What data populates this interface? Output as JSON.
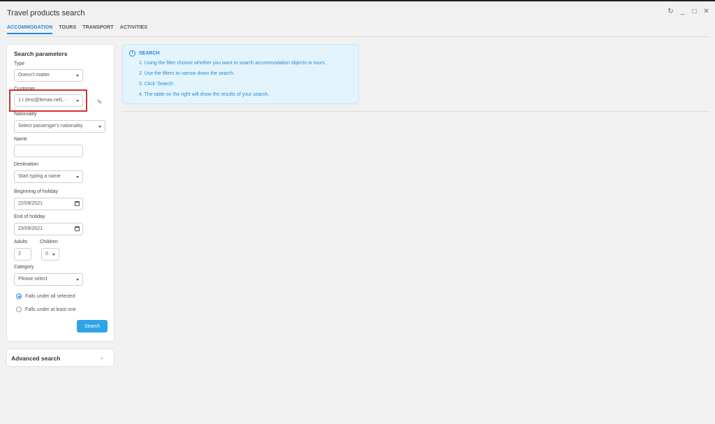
{
  "window": {
    "title": "Travel products search",
    "controls": [
      "refresh-icon",
      "minimize-icon",
      "maximize-icon",
      "close-icon"
    ]
  },
  "tabs": [
    {
      "label": "ACCOMMODATION",
      "active": true
    },
    {
      "label": "TOURS",
      "active": false
    },
    {
      "label": "TRANSPORT",
      "active": false
    },
    {
      "label": "ACTIVITIES",
      "active": false
    }
  ],
  "search_panel": {
    "title": "Search parameters",
    "type": {
      "label": "Type",
      "value": "Doesn't matter"
    },
    "customer": {
      "label": "Customer",
      "value": "1 t (test@lemax.net), -"
    },
    "nationality": {
      "label": "Nationality",
      "value": "Select passenger's nationality"
    },
    "name": {
      "label": "Name",
      "value": ""
    },
    "destination": {
      "label": "Destination",
      "value": "Start typing a name"
    },
    "beginning": {
      "label": "Beginning of holiday",
      "value": "22/09/2021"
    },
    "end": {
      "label": "End of holiday",
      "value": "23/09/2021"
    },
    "adults": {
      "label": "Adults",
      "value": "2"
    },
    "children": {
      "label": "Children",
      "value": "0"
    },
    "category": {
      "label": "Category",
      "value": "Please select"
    },
    "radio_all": "Falls under all selected",
    "radio_one": "Falls under at least one",
    "search_button": "Search"
  },
  "advanced": {
    "title": "Advanced search"
  },
  "info": {
    "title": "SEARCH",
    "lines": [
      "1. Using the filter choose whether you want to search accommodation objects or tours.",
      "2. Use the filters to narrow down the search.",
      "3. Click 'Search'.",
      "4. The table on the right will show the results of your search."
    ]
  },
  "colors": {
    "accent": "#1e88e5",
    "button": "#2fa4e7",
    "highlight": "#d32f2f",
    "info_bg": "#e3f4fd"
  }
}
